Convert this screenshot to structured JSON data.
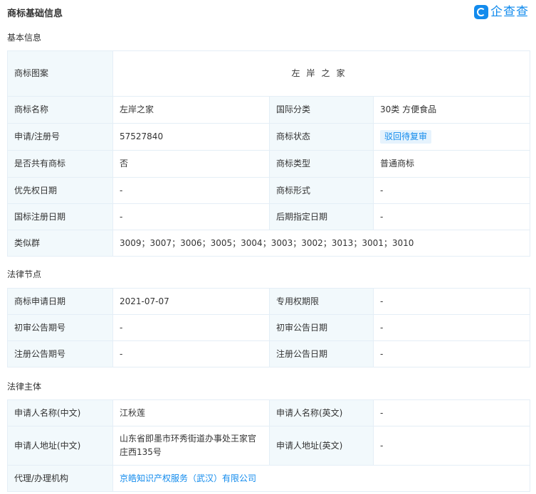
{
  "header": {
    "title": "商标基础信息",
    "brand": "企查查",
    "brand_color": "#128bed"
  },
  "basic": {
    "section_title": "基本信息",
    "image_label": "商标图案",
    "image_text": "左岸之家",
    "rows": [
      {
        "l1": "商标名称",
        "v1": "左岸之家",
        "l2": "国际分类",
        "v2": "30类 方便食品"
      },
      {
        "l1": "申请/注册号",
        "v1": "57527840",
        "l2": "商标状态",
        "v2": "驳回待复审"
      },
      {
        "l1": "是否共有商标",
        "v1": "否",
        "l2": "商标类型",
        "v2": "普通商标"
      },
      {
        "l1": "优先权日期",
        "v1": "-",
        "l2": "商标形式",
        "v2": "-"
      },
      {
        "l1": "国标注册日期",
        "v1": "-",
        "l2": "后期指定日期",
        "v2": "-"
      }
    ],
    "similar_label": "类似群",
    "similar_value": "3009；3007；3006；3005；3004；3003；3002；3013；3001；3010"
  },
  "legal_nodes": {
    "section_title": "法律节点",
    "rows": [
      {
        "l1": "商标申请日期",
        "v1": "2021-07-07",
        "l2": "专用权期限",
        "v2": "-"
      },
      {
        "l1": "初审公告期号",
        "v1": "-",
        "l2": "初审公告日期",
        "v2": "-"
      },
      {
        "l1": "注册公告期号",
        "v1": "-",
        "l2": "注册公告日期",
        "v2": "-"
      }
    ]
  },
  "legal_subject": {
    "section_title": "法律主体",
    "rows": [
      {
        "l1": "申请人名称(中文)",
        "v1": "江秋莲",
        "l2": "申请人名称(英文)",
        "v2": "-"
      },
      {
        "l1": "申请人地址(中文)",
        "v1": "山东省即墨市环秀街道办事处王家官庄西135号",
        "l2": "申请人地址(英文)",
        "v2": "-"
      }
    ],
    "agent_label": "代理/办理机构",
    "agent_value": "京皓知识产权服务（武汉）有限公司"
  }
}
